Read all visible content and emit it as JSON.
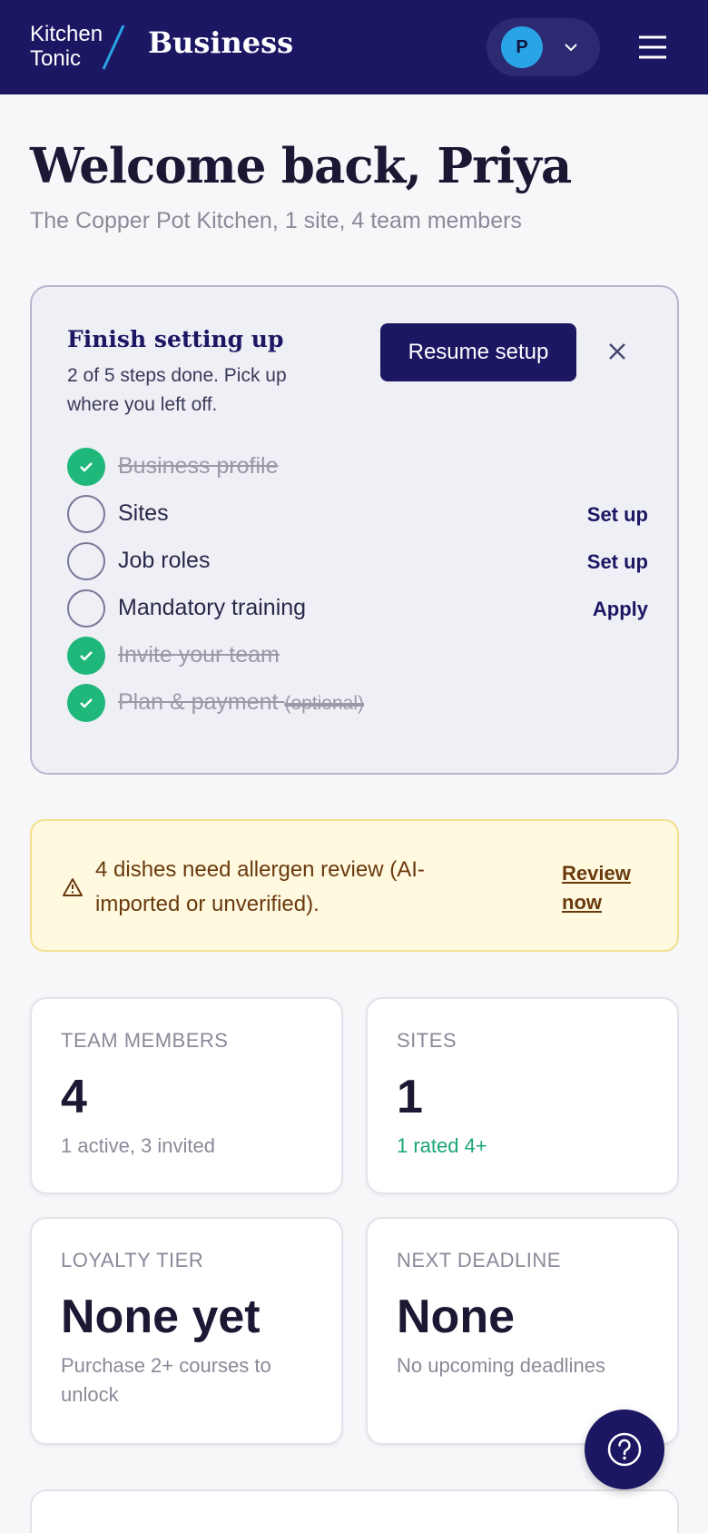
{
  "header": {
    "logo_line1": "Kitchen",
    "logo_line2": "Tonic",
    "product": "Business",
    "avatar_initial": "P",
    "brand_color": "#1b1763",
    "avatar_color": "#29a4e6"
  },
  "welcome": {
    "title": "Welcome back, Priya",
    "subtitle": "The Copper Pot Kitchen, 1 site, 4 team members"
  },
  "setup": {
    "title": "Finish setting up",
    "description": "2 of 5 steps done. Pick up where you left off.",
    "resume_label": "Resume setup",
    "steps": [
      {
        "label": "Business profile",
        "done": true,
        "action": ""
      },
      {
        "label": "Sites",
        "done": false,
        "action": "Set up"
      },
      {
        "label": "Job roles",
        "done": false,
        "action": "Set up"
      },
      {
        "label": "Mandatory training",
        "done": false,
        "action": "Apply"
      },
      {
        "label": "Invite your team",
        "done": true,
        "action": ""
      },
      {
        "label": "Plan & payment",
        "optional": "(optional)",
        "done": true,
        "action": ""
      }
    ],
    "done_color": "#1fb77a"
  },
  "alert": {
    "text": "4 dishes need allergen review (AI-imported or unverified).",
    "link": "Review now",
    "icon": "warning-icon"
  },
  "stats": [
    {
      "label": "TEAM MEMBERS",
      "value": "4",
      "note": "1 active, 3 invited"
    },
    {
      "label": "SITES",
      "value": "1",
      "note": "1 rated 4+"
    },
    {
      "label": "LOYALTY TIER",
      "value": "None yet",
      "note": "Purchase 2+ courses to unlock"
    },
    {
      "label": "NEXT DEADLINE",
      "value": "None",
      "note": "No upcoming deadlines"
    }
  ],
  "help": {
    "icon": "help-icon"
  }
}
